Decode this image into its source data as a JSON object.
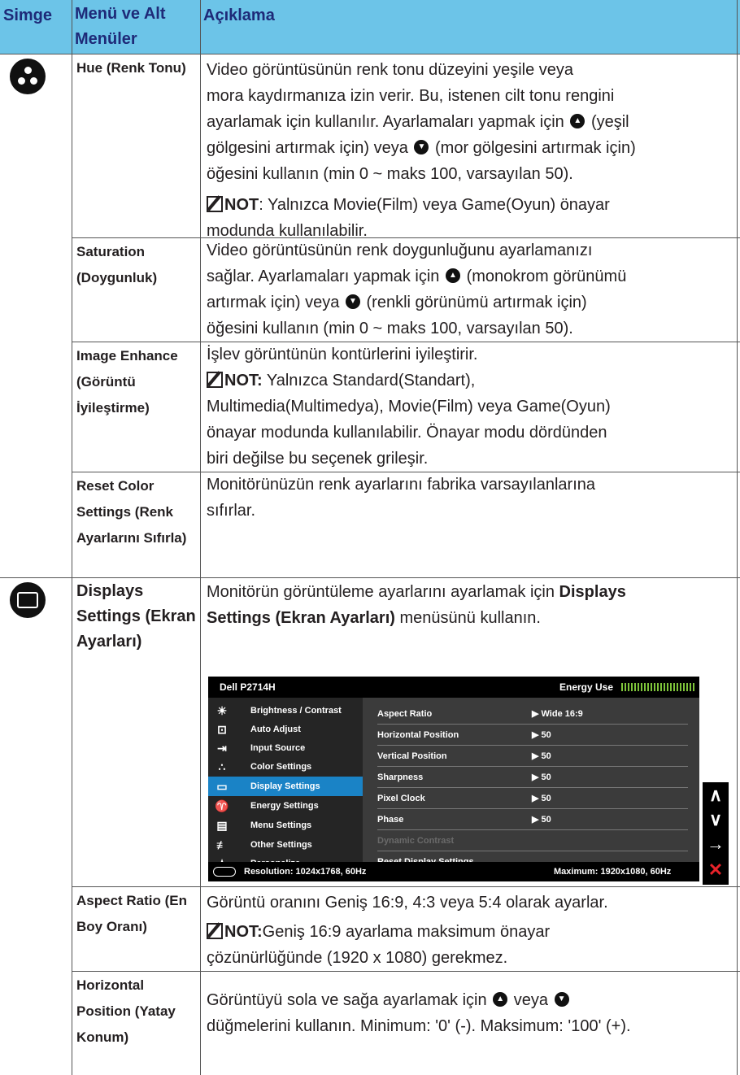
{
  "header": {
    "col_icon": "Simge",
    "col_menu": "Menü ve Alt Menüler",
    "col_desc": "Açıklama"
  },
  "rows": {
    "hue": {
      "name": "Hue (Renk Tonu)",
      "l1": "Video görüntüsünün renk tonu düzeyini yeşile veya",
      "l2": "mora kaydırmanıza izin verir. Bu, istenen cilt tonu rengini",
      "l3a": "ayarlamak için kullanılır. Ayarlamaları yapmak için",
      "l3b": "(yeşil",
      "l4a": "gölgesini artırmak için) veya",
      "l4b": "(mor gölgesini artırmak için)",
      "l5": "öğesini kullanın (min 0 ~ maks 100, varsayılan 50).",
      "note_label": "NOT",
      "note_l1": ": Yalnızca Movie(Film) veya Game(Oyun) önayar",
      "note_l2": "modunda kullanılabilir."
    },
    "saturation": {
      "name": "Saturation (Doygunluk)",
      "l1": "Video görüntüsünün renk doygunluğunu ayarlamanızı",
      "l2a": "sağlar. Ayarlamaları yapmak için",
      "l2b": "(monokrom görünümü",
      "l3a": "artırmak için) veya",
      "l3b": "(renkli görünümü artırmak için)",
      "l4": "öğesini kullanın (min 0 ~ maks 100, varsayılan 50)."
    },
    "image_enhance": {
      "name": "Image Enhance (Görüntü İyileştirme)",
      "l1": "İşlev görüntünün kontürlerini iyileştirir.",
      "note_label": "NOT:",
      "note_l1": " Yalnızca Standard(Standart),",
      "note_l2": "Multimedia(Multimedya), Movie(Film) veya Game(Oyun)",
      "note_l3": "önayar modunda kullanılabilir. Önayar modu dördünden",
      "note_l4": "biri değilse bu seçenek grileşir."
    },
    "reset_color": {
      "name": "Reset Color Settings (Renk Ayarlarını Sıfırla)",
      "l1": "Monitörünüzün renk ayarlarını fabrika varsayılanlarına",
      "l2": "sıfırlar."
    },
    "displays": {
      "name": "Displays Settings (Ekran Ayarları)",
      "l1a": "Monitörün görüntüleme ayarlarını ayarlamak için",
      "l1b": "Displays",
      "l2a": "Settings (Ekran Ayarları)",
      "l2b": " menüsünü kullanın."
    },
    "aspect": {
      "name": "Aspect Ratio (En Boy Oranı)",
      "l1": "Görüntü oranını Geniş 16:9, 4:3 veya 5:4 olarak ayarlar.",
      "note_label": "NOT:",
      "note_l1": "Geniş 16:9 ayarlama maksimum önayar",
      "note_l2": "çözünürlüğünde (1920 x 1080) gerekmez."
    },
    "horizontal": {
      "name": "Horizontal Position (Yatay Konum)",
      "l1a": "Görüntüyü sola ve sağa ayarlamak için",
      "l1b": "veya",
      "l2": "düğmelerini kullanın. Minimum: '0' (-). Maksimum: '100' (+)."
    }
  },
  "osd": {
    "model": "Dell P2714H",
    "energy_label": "Energy Use",
    "menu": [
      "Brightness / Contrast",
      "Auto Adjust",
      "Input Source",
      "Color Settings",
      "Display Settings",
      "Energy Settings",
      "Menu Settings",
      "Other Settings",
      "Personalize"
    ],
    "selected_index": 4,
    "settings": [
      {
        "label": "Aspect Ratio",
        "value": "Wide 16:9"
      },
      {
        "label": "Horizontal Position",
        "value": "50"
      },
      {
        "label": "Vertical Position",
        "value": "50"
      },
      {
        "label": "Sharpness",
        "value": "50"
      },
      {
        "label": "Pixel Clock",
        "value": "50"
      },
      {
        "label": "Phase",
        "value": "50"
      },
      {
        "label": "Dynamic Contrast",
        "value": ""
      },
      {
        "label": "Reset Display Settings",
        "value": ""
      }
    ],
    "resolution": "Resolution: 1024x1768, 60Hz",
    "maximum": "Maximum: 1920x1080, 60Hz"
  }
}
